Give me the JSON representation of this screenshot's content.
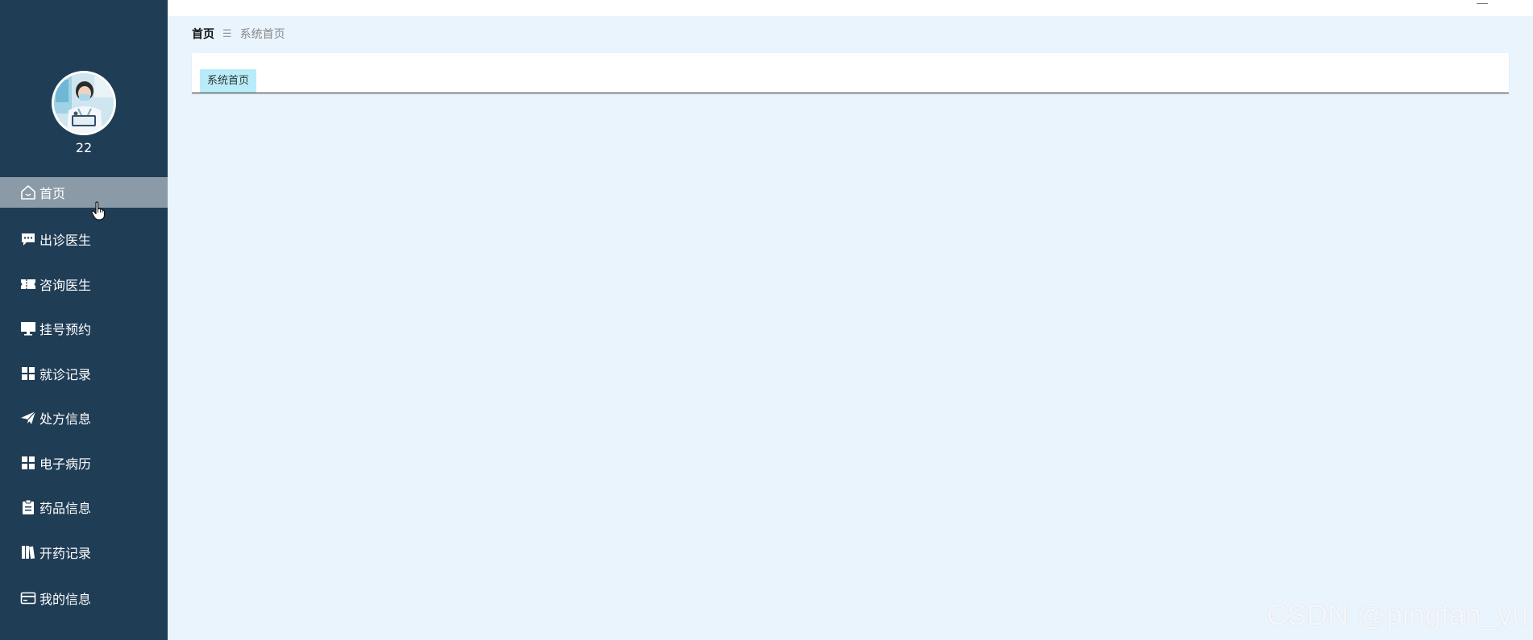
{
  "sidebar": {
    "username": "22",
    "avatar_icon": "doctor-avatar",
    "active_color": "#8a9aa6",
    "bg_color": "#203d56",
    "items": [
      {
        "label": "首页",
        "icon": "home-icon",
        "active": true
      },
      {
        "label": "出诊医生",
        "icon": "chat-icon",
        "active": false
      },
      {
        "label": "咨询医生",
        "icon": "ticket-icon",
        "active": false
      },
      {
        "label": "挂号预约",
        "icon": "monitor-icon",
        "active": false
      },
      {
        "label": "就诊记录",
        "icon": "grid-icon",
        "active": false
      },
      {
        "label": "处方信息",
        "icon": "send-icon",
        "active": false
      },
      {
        "label": "电子病历",
        "icon": "grid-icon",
        "active": false
      },
      {
        "label": "药品信息",
        "icon": "clipboard-icon",
        "active": false
      },
      {
        "label": "开药记录",
        "icon": "book-icon",
        "active": false
      },
      {
        "label": "我的信息",
        "icon": "card-icon",
        "active": false
      }
    ]
  },
  "breadcrumb": {
    "home": "首页",
    "separator": "☰",
    "current": "系统首页"
  },
  "tabs": {
    "active_label": "系统首页",
    "active_color": "#b8ecf8"
  },
  "watermark": "CSDN @pingfan_yu"
}
